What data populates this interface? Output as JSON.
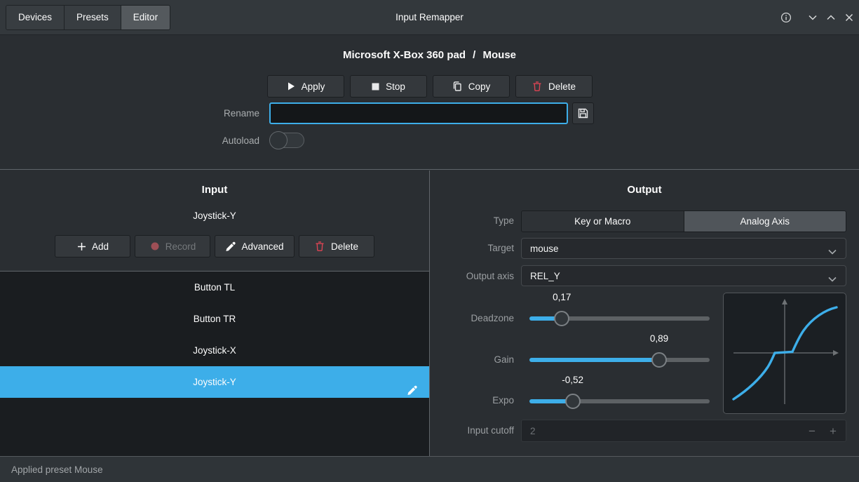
{
  "titlebar": {
    "title": "Input Remapper",
    "tabs": [
      {
        "label": "Devices"
      },
      {
        "label": "Presets"
      },
      {
        "label": "Editor"
      }
    ],
    "active_tab": "Editor"
  },
  "header": {
    "device_name": "Microsoft X-Box 360 pad",
    "path_separator": "/",
    "preset_name": "Mouse",
    "apply_label": "Apply",
    "stop_label": "Stop",
    "copy_label": "Copy",
    "delete_label": "Delete",
    "rename_label": "Rename",
    "rename_value": "",
    "autoload_label": "Autoload",
    "autoload_on": false
  },
  "input_panel": {
    "title": "Input",
    "current_input": "Joystick-Y",
    "add_label": "Add",
    "record_label": "Record",
    "record_enabled": false,
    "advanced_label": "Advanced",
    "delete_label": "Delete",
    "list": [
      {
        "label": "Button TL",
        "selected": false
      },
      {
        "label": "Button TR",
        "selected": false
      },
      {
        "label": "Joystick-X",
        "selected": false
      },
      {
        "label": "Joystick-Y",
        "selected": true
      }
    ]
  },
  "output_panel": {
    "title": "Output",
    "type_label": "Type",
    "type_options": [
      {
        "label": "Key or Macro",
        "selected": false
      },
      {
        "label": "Analog Axis",
        "selected": true
      }
    ],
    "target_label": "Target",
    "target_value": "mouse",
    "output_axis_label": "Output axis",
    "output_axis_value": "REL_Y",
    "sliders": [
      {
        "label": "Deadzone",
        "value": "0,17",
        "percent": 18
      },
      {
        "label": "Gain",
        "value": "0,89",
        "percent": 72
      },
      {
        "label": "Expo",
        "value": "-0,52",
        "percent": 24
      }
    ],
    "input_cutoff_label": "Input cutoff",
    "input_cutoff_value": "2",
    "input_cutoff_enabled": false,
    "spin_minus": "−",
    "spin_plus": "+"
  },
  "statusbar": {
    "message": "Applied preset Mouse"
  },
  "colors": {
    "accent": "#3daee9",
    "danger": "#da4453",
    "curve": "#3daee9"
  }
}
